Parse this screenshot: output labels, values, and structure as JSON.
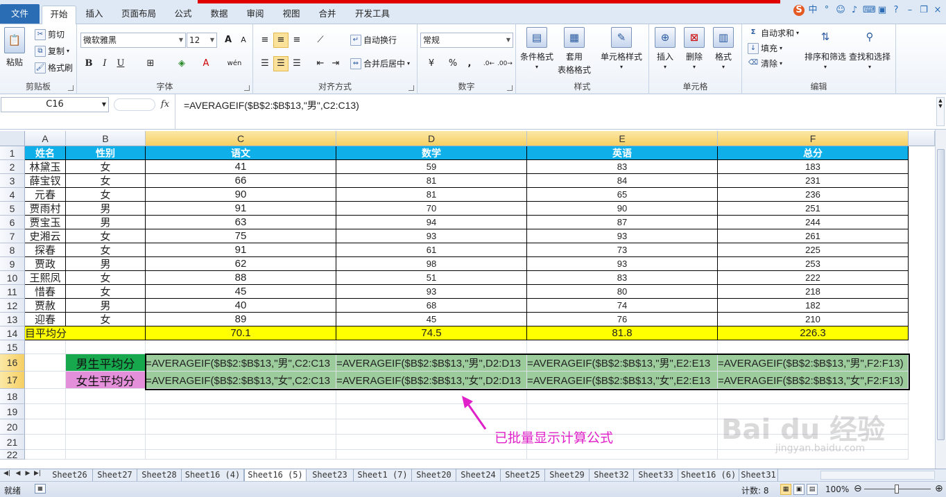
{
  "menu_tabs": [
    "文件",
    "开始",
    "插入",
    "页面布局",
    "公式",
    "数据",
    "审阅",
    "视图",
    "合并",
    "开发工具"
  ],
  "ribbon": {
    "clipboard": {
      "label": "剪贴板",
      "paste": "粘贴",
      "cut": "剪切",
      "copy": "复制",
      "format_painter": "格式刷"
    },
    "font": {
      "label": "字体",
      "name": "微软雅黑",
      "size": "12",
      "bold": "B",
      "italic": "I",
      "underline": "U",
      "grow": "A",
      "shrink": "A",
      "wen": "wén"
    },
    "alignment": {
      "label": "对齐方式",
      "wrap": "自动换行",
      "merge": "合并后居中"
    },
    "number": {
      "label": "数字",
      "format": "常规",
      "percent": "%",
      "comma": ","
    },
    "styles": {
      "label": "样式",
      "conditional": "条件格式",
      "table_format_1": "套用",
      "table_format_2": "表格格式",
      "cell_styles": "单元格样式"
    },
    "cells": {
      "label": "单元格",
      "insert": "插入",
      "delete": "删除",
      "format": "格式"
    },
    "editing": {
      "label": "编辑",
      "autosum": "自动求和",
      "fill": "填充",
      "clear": "清除",
      "sort_filter": "排序和筛选",
      "find_select": "查找和选择"
    }
  },
  "formula_bar": {
    "name_box": "C16",
    "fx": "fx",
    "formula": "=AVERAGEIF($B$2:$B$13,\"男\",C2:C13)"
  },
  "columns": [
    "A",
    "B",
    "C",
    "D",
    "E",
    "F"
  ],
  "rows": [
    "1",
    "2",
    "3",
    "4",
    "5",
    "6",
    "7",
    "8",
    "9",
    "10",
    "11",
    "12",
    "13",
    "14",
    "15",
    "16",
    "17",
    "18",
    "19",
    "20",
    "21",
    "22"
  ],
  "table": {
    "headers": [
      "姓名",
      "性别",
      "语文",
      "数学",
      "英语",
      "总分"
    ],
    "rows": [
      [
        "林黛玉",
        "女",
        "41",
        "59",
        "83",
        "183"
      ],
      [
        "薛宝钗",
        "女",
        "66",
        "81",
        "84",
        "231"
      ],
      [
        "元春",
        "女",
        "90",
        "81",
        "65",
        "236"
      ],
      [
        "贾雨村",
        "男",
        "91",
        "70",
        "90",
        "251"
      ],
      [
        "贾宝玉",
        "男",
        "63",
        "94",
        "87",
        "244"
      ],
      [
        "史湘云",
        "女",
        "75",
        "93",
        "93",
        "261"
      ],
      [
        "探春",
        "女",
        "91",
        "61",
        "73",
        "225"
      ],
      [
        "贾政",
        "男",
        "62",
        "98",
        "93",
        "253"
      ],
      [
        "王熙凤",
        "女",
        "88",
        "51",
        "83",
        "222"
      ],
      [
        "惜春",
        "女",
        "45",
        "93",
        "80",
        "218"
      ],
      [
        "贾赦",
        "男",
        "40",
        "68",
        "74",
        "182"
      ],
      [
        "迎春",
        "女",
        "89",
        "45",
        "76",
        "210"
      ]
    ],
    "avg_label": "目平均分",
    "avg_values": [
      "70.1",
      "74.5",
      "81.8",
      "226.3"
    ]
  },
  "summary": {
    "male_label": "男生平均分",
    "female_label": "女生平均分",
    "male_formulas": [
      "=AVERAGEIF($B$2:$B$13,\"男\",C2:C13",
      "=AVERAGEIF($B$2:$B$13,\"男\",D2:D13",
      "=AVERAGEIF($B$2:$B$13,\"男\",E2:E13",
      "=AVERAGEIF($B$2:$B$13,\"男\",F2:F13)"
    ],
    "female_formulas": [
      "=AVERAGEIF($B$2:$B$13,\"女\",C2:C13",
      "=AVERAGEIF($B$2:$B$13,\"女\",D2:D13",
      "=AVERAGEIF($B$2:$B$13,\"女\",E2:E13",
      "=AVERAGEIF($B$2:$B$13,\"女\",F2:F13)"
    ]
  },
  "annotation": "已批量显示计算公式",
  "watermark": {
    "main": "Bai du 经验",
    "sub": "jingyan.baidu.com"
  },
  "sheet_tabs": [
    "Sheet26",
    "Sheet27",
    "Sheet28",
    "Sheet16 (4)",
    "Sheet16 (5)",
    "Sheet23",
    "Sheet1 (7)",
    "Sheet20",
    "Sheet24",
    "Sheet25",
    "Sheet29",
    "Sheet32",
    "Sheet33",
    "Sheet16 (6)",
    "Sheet31"
  ],
  "active_sheet": "Sheet16 (5)",
  "status": {
    "ready": "就绪",
    "count": "计数: 8",
    "zoom": "100%"
  },
  "colors": {
    "header_blue": "#0fb0ea",
    "avg_yellow": "#ffff00",
    "formula_green": "#9ccc9c",
    "male_label_green": "#17a84d",
    "female_label_pink": "#e38fd9",
    "annotation_magenta": "#e020c8",
    "file_tab_blue": "#2a6db5"
  }
}
